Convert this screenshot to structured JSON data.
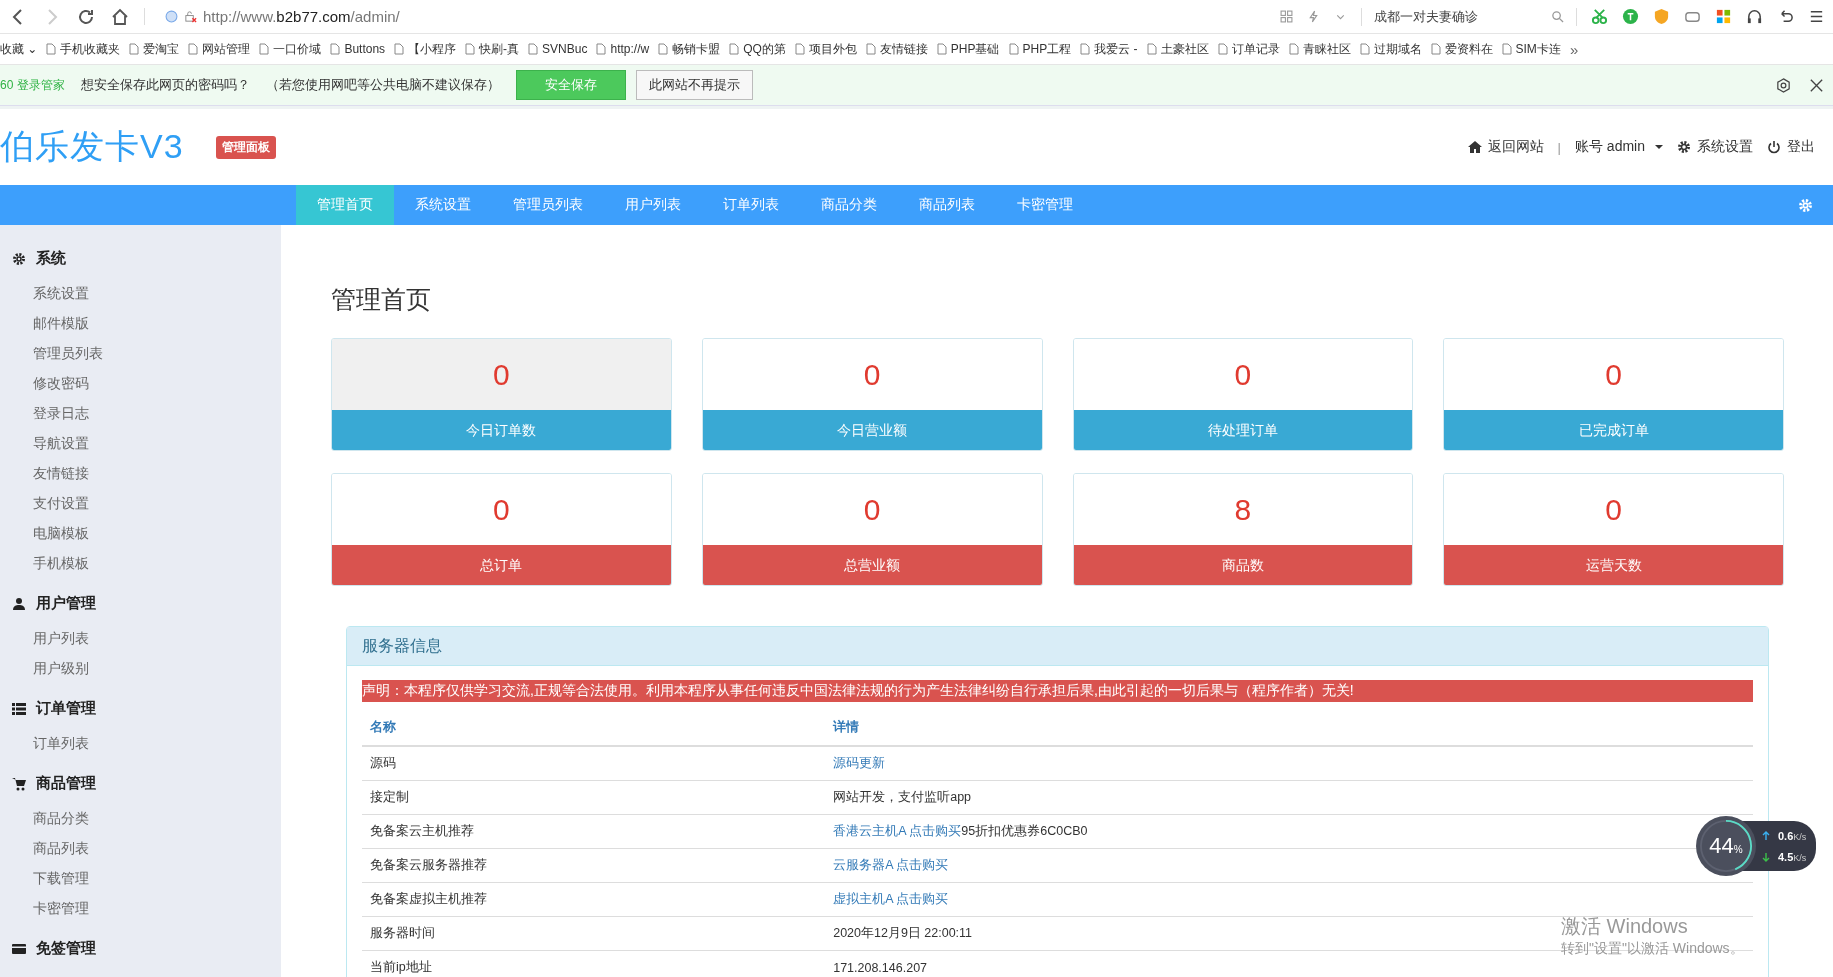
{
  "browser": {
    "url_prefix": "http://www.",
    "url_domain": "b2b77.com",
    "url_path": "/admin/",
    "search_text": "成都一对夫妻确诊",
    "bookmarks": [
      {
        "label": "收藏 ⌄"
      },
      {
        "label": "手机收藏夹"
      },
      {
        "label": "爱淘宝"
      },
      {
        "label": "网站管理"
      },
      {
        "label": "一口价域"
      },
      {
        "label": "Buttons"
      },
      {
        "label": "【小程序"
      },
      {
        "label": "快刷-真"
      },
      {
        "label": "SVNBuc"
      },
      {
        "label": "http://w"
      },
      {
        "label": "畅销卡盟"
      },
      {
        "label": "QQ的第"
      },
      {
        "label": "项目外包"
      },
      {
        "label": "友情链接"
      },
      {
        "label": "PHP基础"
      },
      {
        "label": "PHP工程"
      },
      {
        "label": "我爱云 -"
      },
      {
        "label": "土豪社区"
      },
      {
        "label": "订单记录"
      },
      {
        "label": "青睐社区"
      },
      {
        "label": "过期域名"
      },
      {
        "label": "爱资料在"
      },
      {
        "label": "SIM卡连"
      }
    ],
    "bookmarks_more": "»"
  },
  "password_bar": {
    "brand": "60 登录管家",
    "question": "想安全保存此网页的密码吗？",
    "note": "（若您使用网吧等公共电脑不建议保存）",
    "save_button": "安全保存",
    "never_button": "此网站不再提示"
  },
  "header": {
    "logo": "伯乐发卡V3",
    "badge": "管理面板",
    "links": {
      "home": "返回网站",
      "separator": "|",
      "account": "账号 admin",
      "settings": "系统设置",
      "logout": "登出"
    }
  },
  "nav": [
    {
      "label": "管理首页",
      "selected": true
    },
    {
      "label": "系统设置",
      "selected": false
    },
    {
      "label": "管理员列表",
      "selected": false
    },
    {
      "label": "用户列表",
      "selected": false
    },
    {
      "label": "订单列表",
      "selected": false
    },
    {
      "label": "商品分类",
      "selected": false
    },
    {
      "label": "商品列表",
      "selected": false
    },
    {
      "label": "卡密管理",
      "selected": false
    }
  ],
  "sidebar": [
    {
      "title": "系统",
      "items": [
        "系统设置",
        "邮件模版",
        "管理员列表",
        "修改密码",
        "登录日志",
        "导航设置",
        "友情链接",
        "支付设置",
        "电脑模板",
        "手机模板"
      ]
    },
    {
      "title": "用户管理",
      "items": [
        "用户列表",
        "用户级别"
      ]
    },
    {
      "title": "订单管理",
      "items": [
        "订单列表"
      ]
    },
    {
      "title": "商品管理",
      "items": [
        "商品分类",
        "商品列表",
        "下载管理",
        "卡密管理"
      ]
    },
    {
      "title": "免签管理"
    }
  ],
  "page_title": "管理首页",
  "stats": [
    {
      "value": "0",
      "label": "今日订单数",
      "color": "#39a9d4"
    },
    {
      "value": "0",
      "label": "今日营业额",
      "color": "#39a9d4"
    },
    {
      "value": "0",
      "label": "待处理订单",
      "color": "#39a9d4"
    },
    {
      "value": "0",
      "label": "已完成订单",
      "color": "#39a9d4"
    },
    {
      "value": "0",
      "label": "总订单",
      "color": "#d9534f"
    },
    {
      "value": "0",
      "label": "总营业额",
      "color": "#d9534f"
    },
    {
      "value": "8",
      "label": "商品数",
      "color": "#d9534f"
    },
    {
      "value": "0",
      "label": "运营天数",
      "color": "#d9534f"
    }
  ],
  "server_panel": {
    "title": "服务器信息",
    "notice": "声明：本程序仅供学习交流,正规等合法使用。利用本程序从事任何违反中国法律法规的行为产生法律纠纷自行承担后果,由此引起的一切后果与（程序作者）无关!",
    "columns": [
      "名称",
      "详情"
    ],
    "rows": [
      {
        "name": "源码",
        "link": "源码更新"
      },
      {
        "name": "接定制",
        "text": "网站开发，支付监听app"
      },
      {
        "name": "免备案云主机推荐",
        "link": "香港云主机A 点击购买",
        "text": "95折扣优惠券6C0CB0"
      },
      {
        "name": "免备案云服务器推荐",
        "link": "云服务器A 点击购买"
      },
      {
        "name": "免备案虚拟主机推荐",
        "link": "虚拟主机A 点击购买"
      },
      {
        "name": "服务器时间",
        "text": "2020年12月9日 22:00:11"
      },
      {
        "name": "当前ip地址",
        "text": "171.208.146.207"
      }
    ]
  },
  "net_widget": {
    "usage": "44",
    "usage_unit": "%",
    "level": 0.44,
    "upload": "0.6",
    "download": "4.5",
    "upload_unit": "K/s",
    "download_unit": "K/s"
  },
  "activation": {
    "title": "激活 Windows",
    "hint": "转到\"设置\"以激活 Windows。"
  }
}
